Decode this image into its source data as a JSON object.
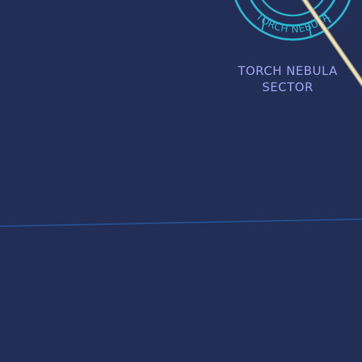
{
  "map": {
    "background_color": "#232e57",
    "feature_color": "#2bb8cf",
    "route_color": "#ece3bd",
    "grid_line_color": "#24508f",
    "label_color": "#a3a6ee",
    "sector_label": {
      "line1": "TORCH NEBULA",
      "line2": "SECTOR"
    },
    "ring_label": "TORCH NEBULA"
  }
}
